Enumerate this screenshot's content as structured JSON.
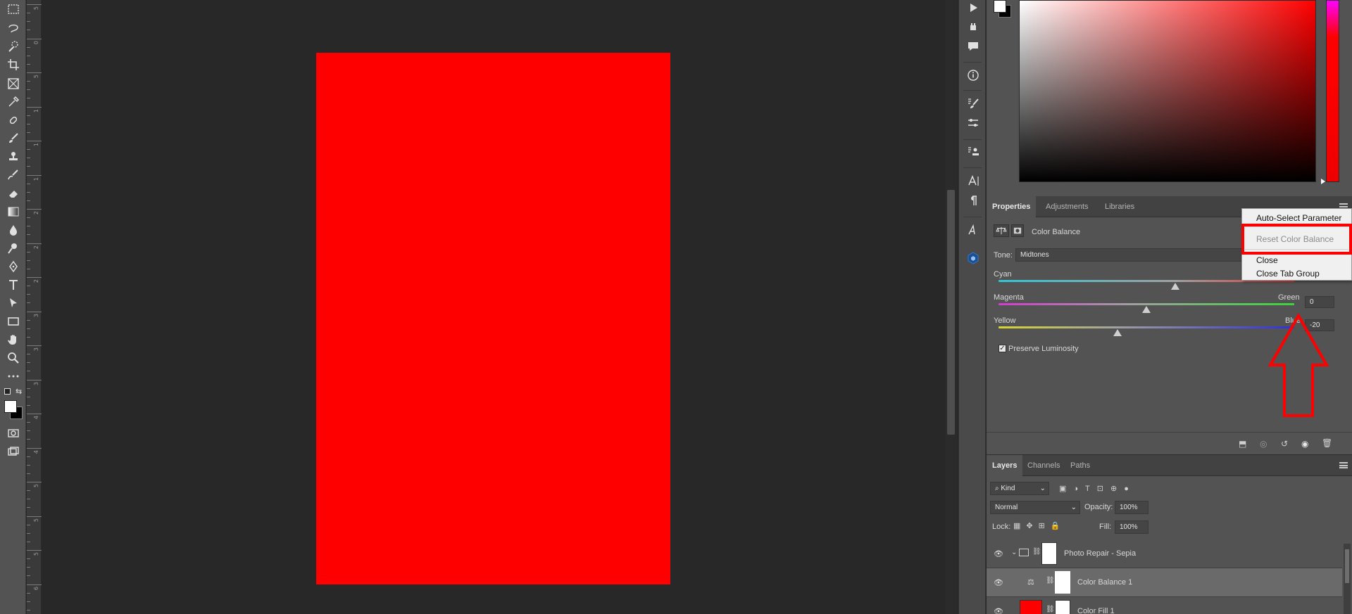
{
  "toolbar": {
    "tools": [
      "marquee-tool",
      "lasso-tool",
      "quick-select-tool",
      "crop-tool",
      "frame-tool",
      "eyedropper-tool",
      "healing-brush-tool",
      "brush-tool",
      "clone-stamp-tool",
      "history-brush-tool",
      "eraser-tool",
      "gradient-tool",
      "blur-tool",
      "dodge-tool",
      "pen-tool",
      "type-tool",
      "path-select-tool",
      "rectangle-tool",
      "hand-tool",
      "zoom-tool",
      "more-tools"
    ]
  },
  "ruler": {
    "labels": [
      "5",
      "0",
      "5",
      "1",
      "1",
      "1",
      "2",
      "2",
      "2",
      "3",
      "3",
      "3",
      "4",
      "4",
      "5",
      "5",
      "5",
      "6"
    ]
  },
  "colors": {
    "document_fill": "#ff0000",
    "panel_bg": "#535353",
    "highlight": "#ff0000"
  },
  "properties": {
    "tabs": [
      "Properties",
      "Adjustments",
      "Libraries"
    ],
    "active_tab": "Properties",
    "adjustment_title": "Color Balance",
    "tone_label": "Tone:",
    "tone_value": "Midtones",
    "sliders": [
      {
        "left": "Cyan",
        "right": "",
        "value": ""
      },
      {
        "left": "Magenta",
        "right": "Green",
        "value": "0"
      },
      {
        "left": "Yellow",
        "right": "Blue",
        "value": "-20"
      }
    ],
    "preserve_luminosity_label": "Preserve Luminosity",
    "preserve_luminosity_checked": true
  },
  "context_menu": {
    "items": [
      {
        "label": "Auto-Select Parameter",
        "enabled": true
      },
      {
        "label": "Reset Color Balance",
        "enabled": false
      },
      {
        "label": "Close",
        "enabled": true
      },
      {
        "label": "Close Tab Group",
        "enabled": true
      }
    ]
  },
  "layers": {
    "tabs": [
      "Layers",
      "Channels",
      "Paths"
    ],
    "active_tab": "Layers",
    "filter_kind": "Kind",
    "blend_mode": "Normal",
    "opacity_label": "Opacity:",
    "opacity_value": "100%",
    "lock_label": "Lock:",
    "fill_label": "Fill:",
    "fill_value": "100%",
    "items": [
      {
        "name": "Photo Repair - Sepia",
        "type": "group"
      },
      {
        "name": "Color Balance 1",
        "type": "adjustment",
        "selected": true
      },
      {
        "name": "Color Fill 1",
        "type": "fill"
      }
    ]
  }
}
